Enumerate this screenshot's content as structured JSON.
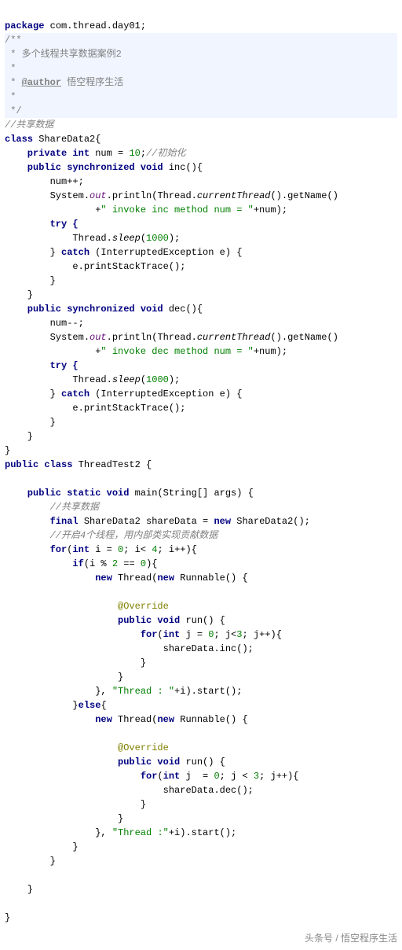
{
  "pkg": {
    "kw": "package",
    "name": " com.thread.day01;"
  },
  "doc": {
    "open": "/**",
    "l1": " * 多个线程共享数据案例2",
    "l2": " *",
    "l3a": " * ",
    "l3tag": "@author",
    "l3b": " 悟空程序生活",
    "l4": " *",
    "l5": " */"
  },
  "cmt_share": "//共享数据",
  "cls1": {
    "kw": "class",
    "name": " ShareData2{"
  },
  "num": {
    "mod": "    private int",
    "decl": " num = ",
    "val": "10",
    "semi": ";",
    "c": "//初始化"
  },
  "inc_sig": {
    "mod": "    public synchronized void",
    "name": " inc(){"
  },
  "line_numpp": "        num++;",
  "print_inc": {
    "a": "        System.",
    "out": "out",
    "b": ".println(Thread.",
    "cur": "currentThread",
    "c": "().getName()"
  },
  "print_inc2": {
    "a": "                +",
    "s": "\" invoke inc method num = \"",
    "b": "+num);"
  },
  "try": "        try {",
  "sleep": {
    "a": "            Thread.",
    "m": "sleep",
    "b": "(",
    "v": "1000",
    "c": ");"
  },
  "catch": {
    "a": "        } ",
    "kw": "catch",
    "b": " (InterruptedException e) {"
  },
  "pst": "            e.printStackTrace();",
  "close1": "        }",
  "close2": "    }",
  "dec_sig": {
    "mod": "    public synchronized void",
    "name": " dec(){"
  },
  "line_nummm": "        num--;",
  "print_dec": {
    "a": "        System.",
    "out": "out",
    "b": ".println(Thread.",
    "cur": "currentThread",
    "c": "().getName()"
  },
  "print_dec2": {
    "a": "                +",
    "s": "\" invoke dec method num = \"",
    "b": "+num);"
  },
  "close_cls1": "}",
  "cls2": {
    "mod": "public class",
    "name": " ThreadTest2 {"
  },
  "main": {
    "mod": "    public static void",
    "name": " main(String[] args) {"
  },
  "cmt_share2": "        //共享数据",
  "sharedata": {
    "kw": "        final",
    "b": " ShareData2 shareData = ",
    "n": "new",
    "c": " ShareData2();"
  },
  "cmt_open": "        //开启4个线程，用内部类实现贡献数据",
  "for1": {
    "kw": "        for",
    "a": "(",
    "int": "int",
    "b": " i = ",
    "z": "0",
    "c": "; i< ",
    "four": "4",
    "d": "; i++){"
  },
  "if1": {
    "kw": "            if",
    "a": "(i % ",
    "two": "2",
    "b": " == ",
    "z": "0",
    "c": "){"
  },
  "newthread1": {
    "a": "                ",
    "n1": "new",
    "b": " Thread(",
    "n2": "new",
    "c": " Runnable() {"
  },
  "override": "                    @Override",
  "run_sig": {
    "mod": "                    public void",
    "name": " run() {"
  },
  "for2": {
    "kw": "                        for",
    "a": "(",
    "int": "int",
    "b": " j = ",
    "z": "0",
    "c": "; j<",
    "three": "3",
    "d": "; j++){"
  },
  "call_inc": "                            shareData.inc();",
  "close_for2": "                        }",
  "close_run": "                    }",
  "start1": {
    "a": "                }, ",
    "s": "\"Thread : \"",
    "b": "+i).start();"
  },
  "else1": {
    "a": "            }",
    "kw": "else",
    "b": "{"
  },
  "newthread2": {
    "a": "                ",
    "n1": "new",
    "b": " Thread(",
    "n2": "new",
    "c": " Runnable() {"
  },
  "for3": {
    "kw": "                        for",
    "a": "(",
    "int": "int",
    "b": " j  = ",
    "z": "0",
    "c": "; j < ",
    "three": "3",
    "d": "; j++){"
  },
  "call_dec": "                            shareData.dec();",
  "start2": {
    "a": "                }, ",
    "s": "\"Thread :\"",
    "b": "+i).start();"
  },
  "close_if": "            }",
  "close_for1": "        }",
  "close_main": "    }",
  "close_cls2": "}",
  "footer": "头条号 / 悟空程序生活"
}
